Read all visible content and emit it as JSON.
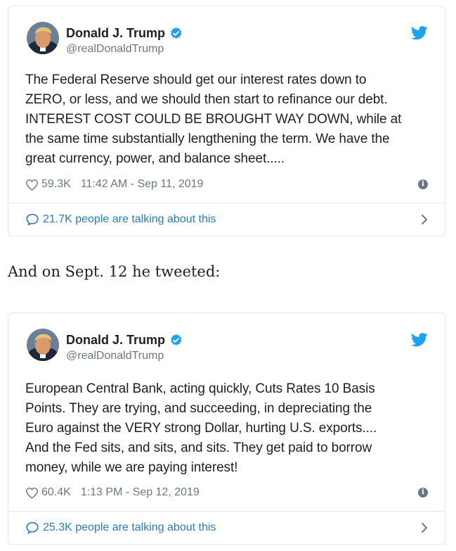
{
  "tweets": [
    {
      "display_name": "Donald J. Trump",
      "handle": "@realDonaldTrump",
      "text_lines": [
        "The Federal Reserve should get our interest rates down to",
        "ZERO, or less, and we should then start to refinance our debt.",
        "INTEREST COST COULD BE BROUGHT WAY DOWN, while at",
        "the same time substantially lengthening the term. We have the",
        "great currency, power, and balance sheet....."
      ],
      "likes": "59.3K",
      "timestamp": "11:42 AM - Sep 11, 2019",
      "talking": "21.7K people are talking about this"
    },
    {
      "display_name": "Donald J. Trump",
      "handle": "@realDonaldTrump",
      "text_lines": [
        "European Central Bank, acting quickly, Cuts Rates 10 Basis",
        "Points. They are trying, and succeeding, in depreciating the",
        "Euro against the VERY strong Dollar, hurting U.S. exports....",
        "And the Fed sits, and sits, and sits. They get paid to borrow",
        "money, while we are paying interest!"
      ],
      "likes": "60.4K",
      "timestamp": "1:13 PM - Sep 12, 2019",
      "talking": "25.3K people are talking about this"
    }
  ],
  "between_text": "And on Sept. 12 he tweeted:",
  "colors": {
    "twitter_blue": "#1da1f2",
    "link_blue": "#2b7bb9",
    "muted": "#697882",
    "border": "#e1e8ed"
  },
  "icons": {
    "verified": "verified-badge-icon",
    "bird": "twitter-bird-icon",
    "heart": "heart-icon",
    "info": "info-icon",
    "bubble": "speech-bubble-icon",
    "chevron": "chevron-right-icon"
  }
}
